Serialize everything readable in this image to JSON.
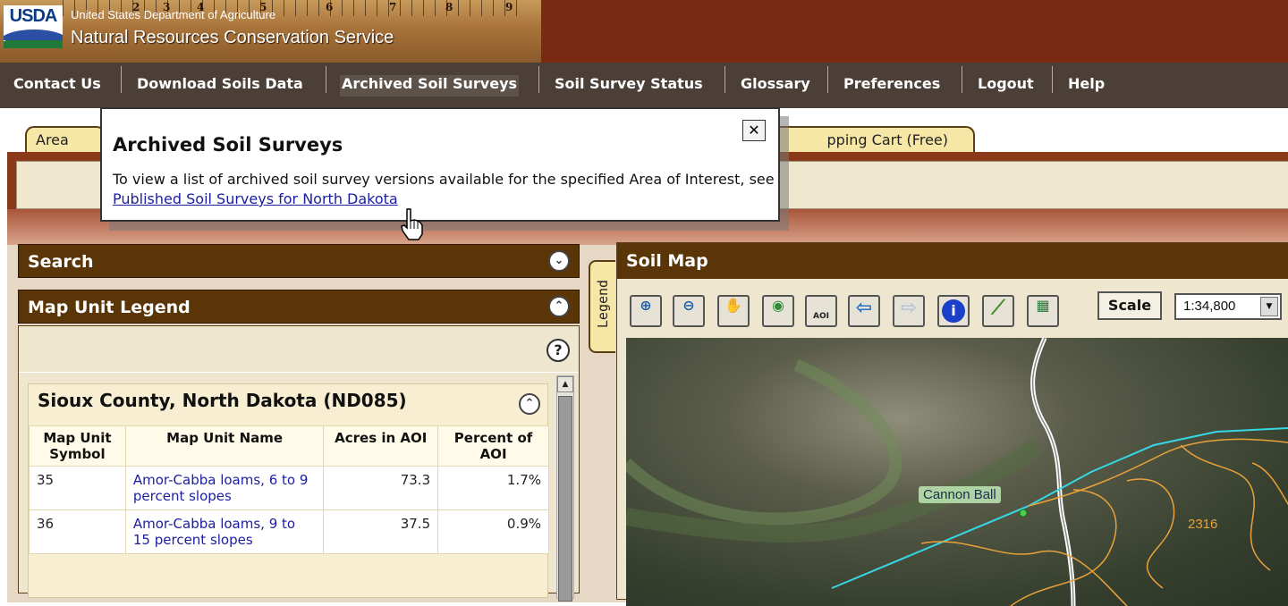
{
  "header": {
    "logo_text": "USDA",
    "department": "United States Department of Agriculture",
    "agency": "Natural Resources Conservation Service",
    "ruler_numbers": [
      "2",
      "3",
      "4",
      "5",
      "6",
      "7",
      "8",
      "9"
    ]
  },
  "nav": {
    "items": [
      "Contact Us",
      "Download Soils Data",
      "Archived Soil Surveys",
      "Soil Survey Status",
      "Glossary",
      "Preferences",
      "Logout",
      "Help"
    ],
    "active": "Archived Soil Surveys"
  },
  "tabs": {
    "area_label_partial": "Area",
    "shopping_label_partial": "pping Cart (Free)"
  },
  "popup": {
    "title": "Archived Soil Surveys",
    "close_glyph": "✕",
    "body_text": "To view a list of archived soil survey versions available for the specified Area of Interest, see ",
    "link_text": "Published Soil Surveys for North Dakota"
  },
  "search_panel": {
    "title": "Search",
    "toggle_glyph": "⌄"
  },
  "legend_panel": {
    "title": "Map Unit Legend",
    "toggle_glyph": "⌃",
    "help_glyph": "?",
    "survey_title": "Sioux County, North Dakota (ND085)",
    "columns": [
      "Map Unit Symbol",
      "Map Unit Name",
      "Acres in AOI",
      "Percent of AOI"
    ],
    "rows": [
      {
        "symbol": "35",
        "name": "Amor-Cabba loams, 6 to 9 percent slopes",
        "acres": "73.3",
        "percent": "1.7%"
      },
      {
        "symbol": "36",
        "name": "Amor-Cabba loams, 9 to 15 percent slopes",
        "acres": "37.5",
        "percent": "0.9%"
      }
    ]
  },
  "side_tab": {
    "label": "Legend"
  },
  "map_panel": {
    "title": "Soil Map",
    "tools": [
      {
        "name": "zoom-in-icon",
        "glyph": "⊕"
      },
      {
        "name": "zoom-out-icon",
        "glyph": "⊖"
      },
      {
        "name": "pan-hand-icon",
        "glyph": "✋"
      },
      {
        "name": "full-extent-globe-icon",
        "glyph": "◉"
      },
      {
        "name": "aoi-tool-icon",
        "glyph": "AOI"
      },
      {
        "name": "back-arrow-icon",
        "glyph": "⇦"
      },
      {
        "name": "forward-arrow-icon",
        "glyph": "⇨"
      },
      {
        "name": "identify-info-icon",
        "glyph": "i"
      },
      {
        "name": "measure-ruler-icon",
        "glyph": "⟋"
      },
      {
        "name": "clear-selection-icon",
        "glyph": "▦"
      }
    ],
    "scale_button": "Scale",
    "scale_value": "1:34,800",
    "map_labels": {
      "place": "Cannon Ball",
      "unit_number": "2316"
    }
  },
  "colors": {
    "nav_bg": "#4b3f37",
    "panel_header": "#5a3508",
    "banner": "#7a2a12",
    "aoi_boundary": "#37d7e6",
    "soil_lines": "#e8a23a",
    "link": "#1b1e9f"
  }
}
